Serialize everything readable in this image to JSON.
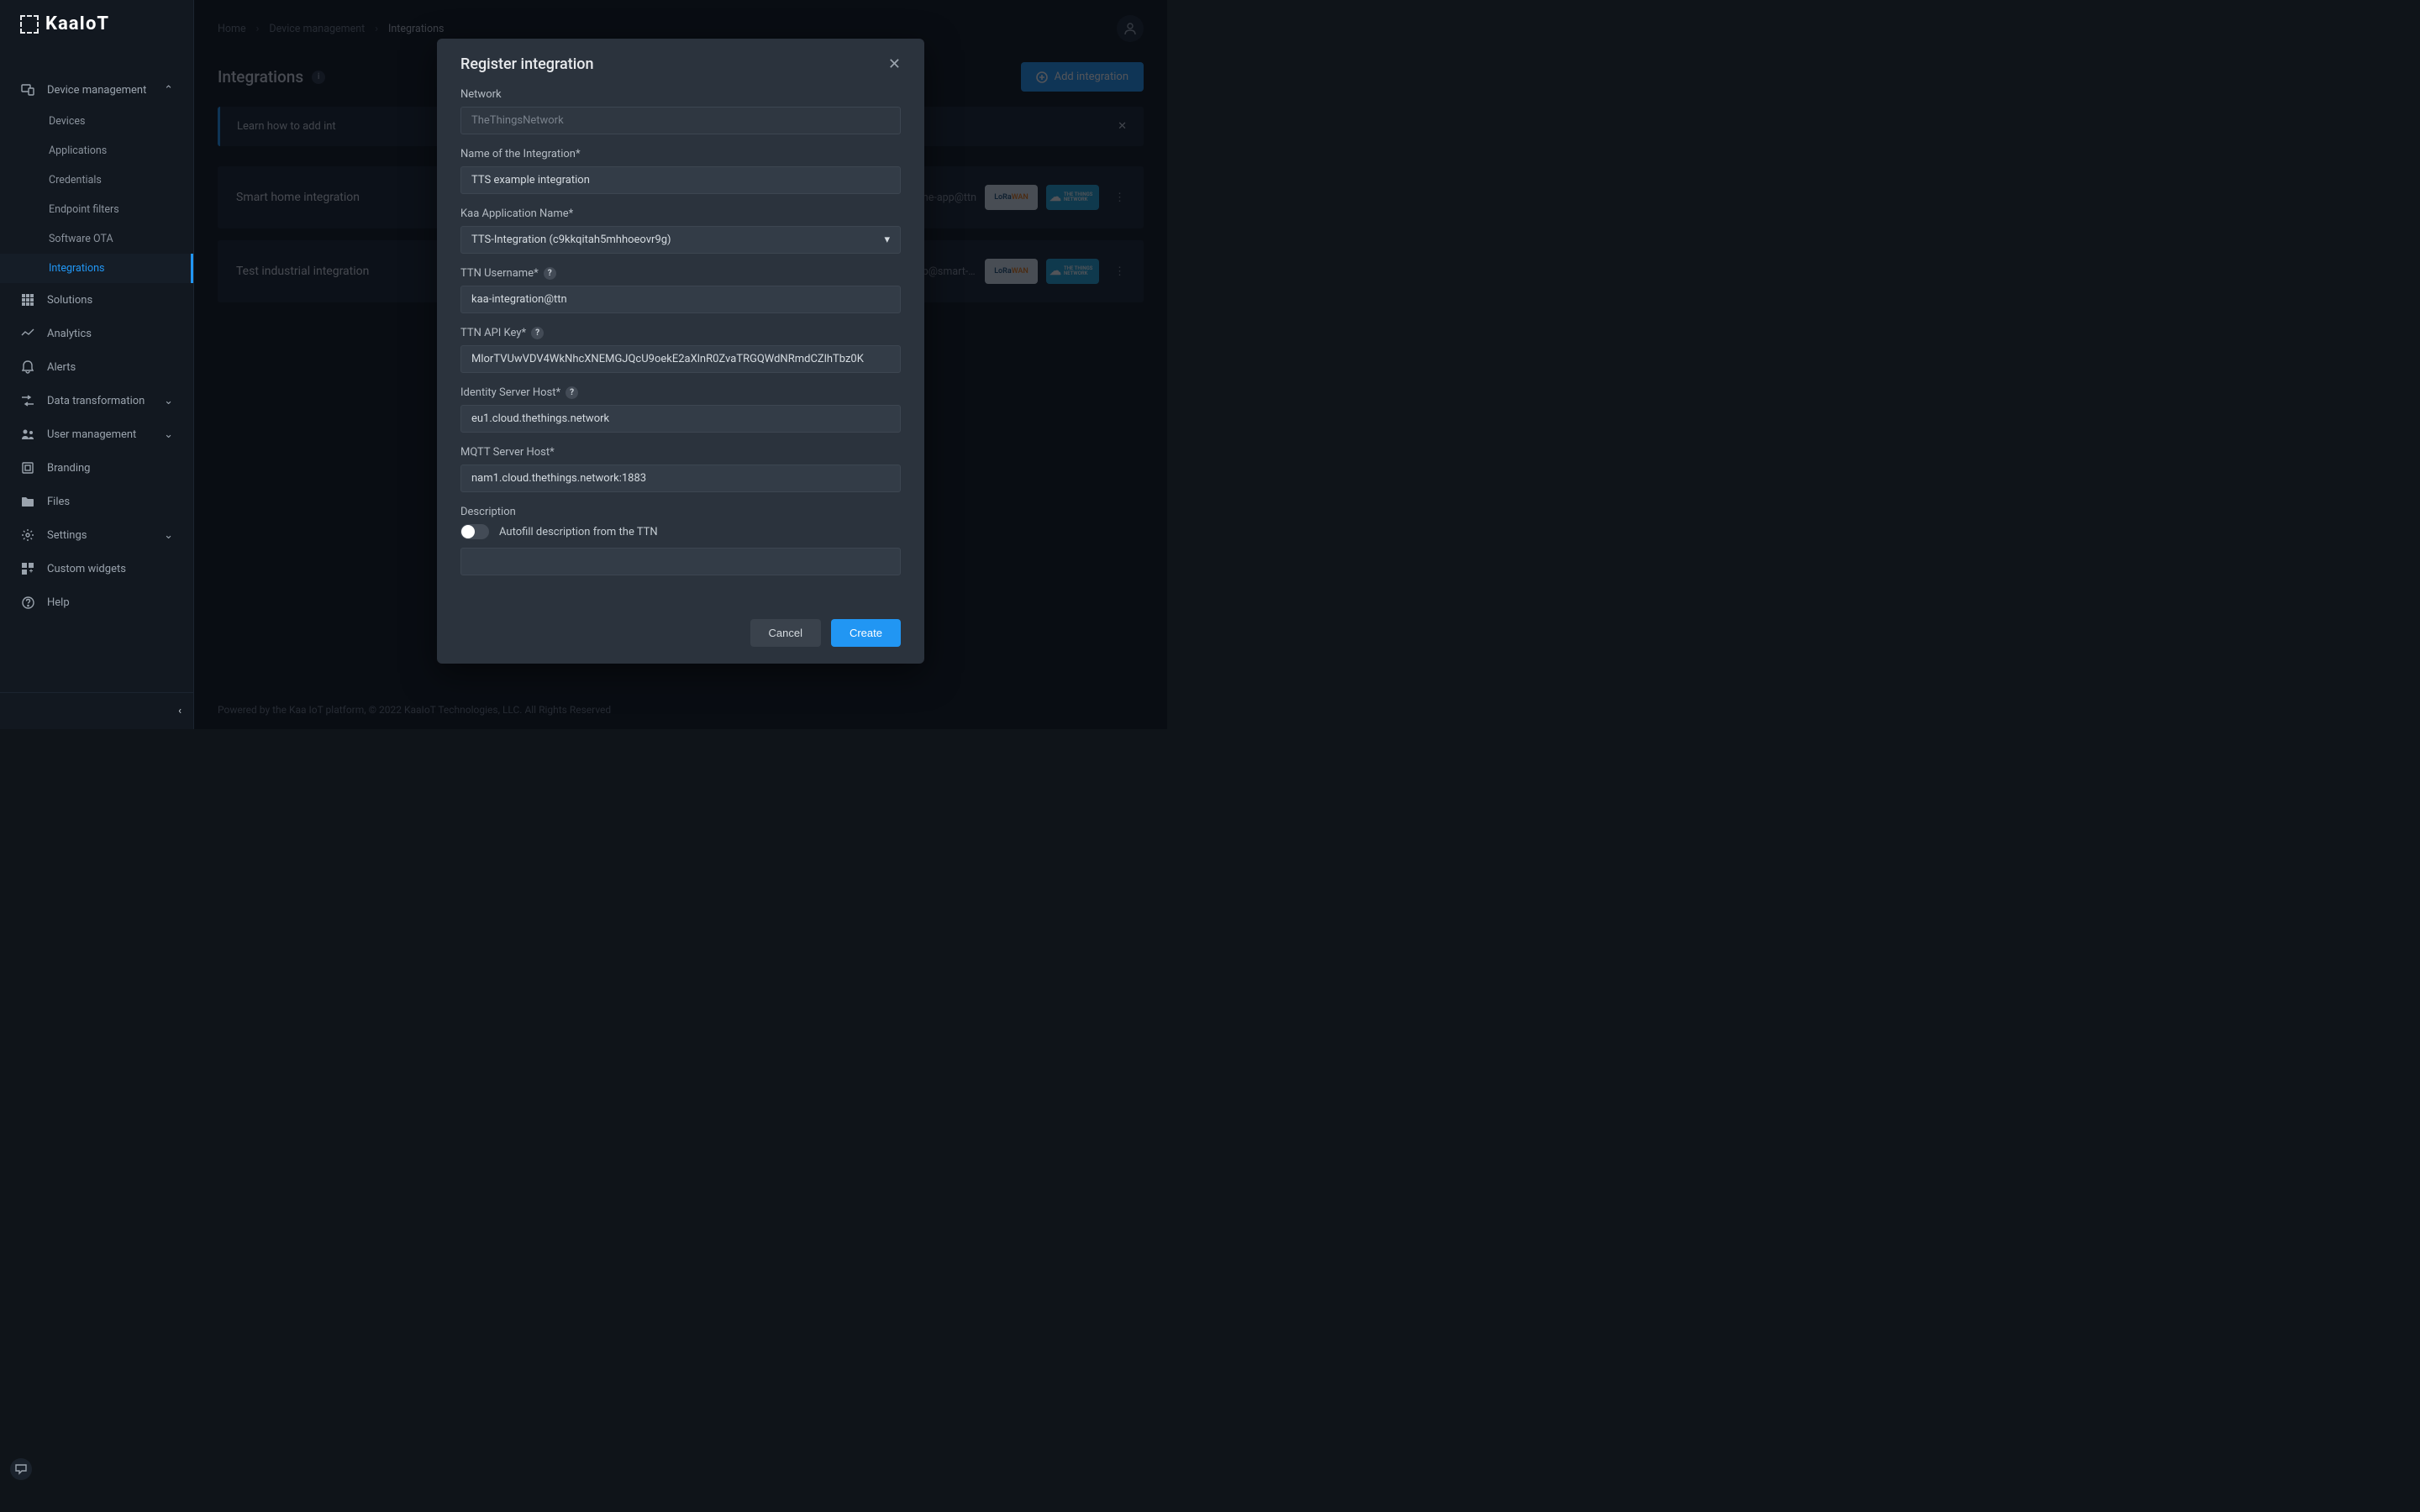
{
  "logo_text": "KaaIoT",
  "breadcrumb": {
    "items": [
      "Home",
      "Device management",
      "Integrations"
    ]
  },
  "page": {
    "title": "Integrations",
    "add_button": "Add integration",
    "banner": "Learn how to add int"
  },
  "sidebar": {
    "device_mgmt": "Device management",
    "subs": [
      "Devices",
      "Applications",
      "Credentials",
      "Endpoint filters",
      "Software OTA",
      "Integrations"
    ],
    "solutions": "Solutions",
    "analytics": "Analytics",
    "alerts": "Alerts",
    "data_transformation": "Data transformation",
    "user_mgmt": "User management",
    "branding": "Branding",
    "files": "Files",
    "settings": "Settings",
    "custom_widgets": "Custom widgets",
    "help": "Help"
  },
  "integrations": [
    {
      "name": "Smart home integration",
      "app": "smart-home-app@ttn",
      "lora": "LoRaWAN",
      "ttn": "THE THINGS NETWORK"
    },
    {
      "name": "Test industrial integration",
      "app": "smart-tester-app@smart-te…",
      "lora": "LoRaWAN",
      "ttn": "THE THINGS NETWORK"
    }
  ],
  "footer": "Powered by the Kaa IoT platform, © 2022 KaaIoT Technologies, LLC.  All Rights Reserved",
  "modal": {
    "title": "Register integration",
    "labels": {
      "network": "Network",
      "name": "Name of the Integration*",
      "kaa_app": "Kaa Application Name*",
      "ttn_user": "TTN Username*",
      "ttn_key": "TTN API Key*",
      "identity_host": "Identity Server Host*",
      "mqtt_host": "MQTT Server Host*",
      "description": "Description",
      "autofill": "Autofill description from the TTN"
    },
    "values": {
      "network": "TheThingsNetwork",
      "name": "TTS example integration",
      "kaa_app": "TTS-Integration (c9kkqitah5mhhoeovr9g)",
      "ttn_user": "kaa-integration@ttn",
      "ttn_key": "MlorTVUwVDV4WkNhcXNEMGJQcU9oekE2aXlnR0ZvaTRGQWdNRmdCZlhTbz0K",
      "identity_host": "eu1.cloud.thethings.network",
      "mqtt_host": "nam1.cloud.thethings.network:1883",
      "description": ""
    },
    "buttons": {
      "cancel": "Cancel",
      "create": "Create"
    }
  }
}
